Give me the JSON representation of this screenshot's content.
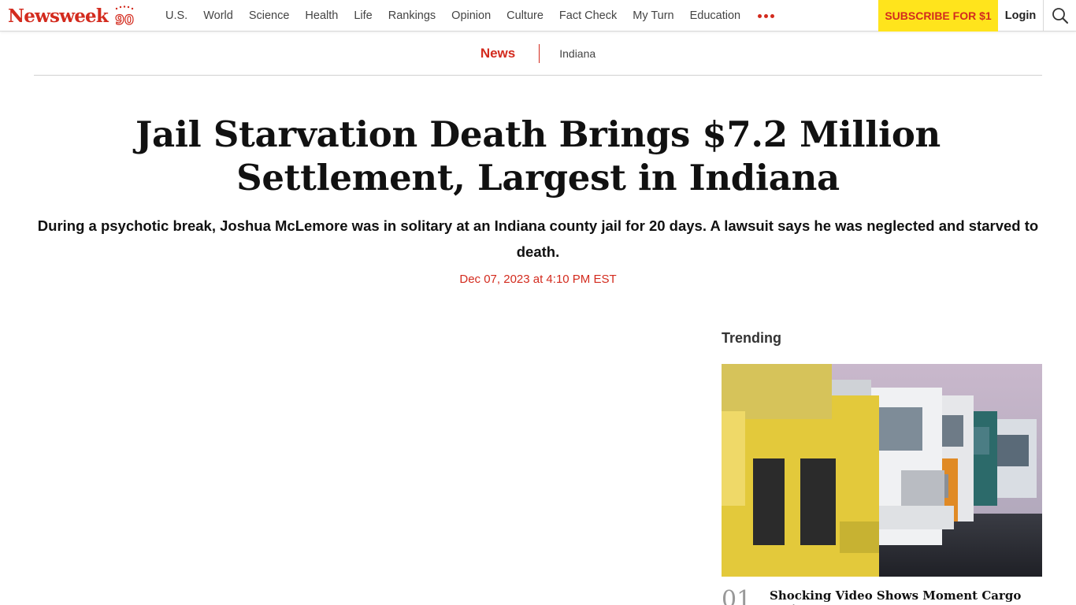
{
  "brand": {
    "name": "Newsweek",
    "anniversary": "90",
    "color": "#d32b1e"
  },
  "nav": {
    "links": [
      "U.S.",
      "World",
      "Science",
      "Health",
      "Life",
      "Rankings",
      "Opinion",
      "Culture",
      "Fact Check",
      "My Turn",
      "Education"
    ],
    "more_icon": "more-dots-icon",
    "subscribe_label": "SUBSCRIBE FOR $1",
    "subscribe_bg": "#ffe41c",
    "login_label": "Login",
    "search_icon": "search-icon"
  },
  "breadcrumb": {
    "section": "News",
    "tag": "Indiana"
  },
  "article": {
    "headline": "Jail Starvation Death Brings $7.2 Million Settlement, Largest in Indiana",
    "dek": "During a psychotic break, Joshua McLemore was in solitary at an Indiana county jail for 20 days. A lawsuit says he was neglected and starved to death.",
    "dateline": "Dec 07, 2023 at 4:10 PM EST"
  },
  "trending": {
    "title": "Trending",
    "items": [
      {
        "number": "01",
        "headline": "Shocking Video Shows Moment Cargo Train"
      }
    ]
  }
}
